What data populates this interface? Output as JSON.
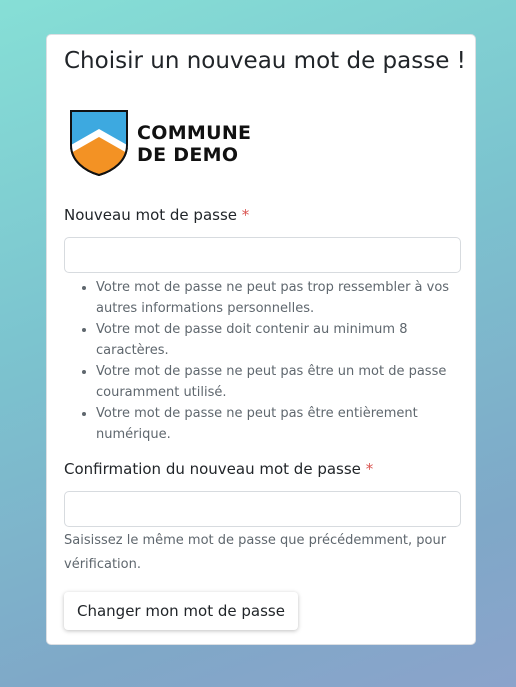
{
  "page": {
    "title": "Choisir un nouveau mot de passe !"
  },
  "logo": {
    "line1": "COMMUNE",
    "line2": "DE DEMO",
    "colors": {
      "sky": "#3da9e0",
      "orange": "#f39224",
      "outline": "#111111"
    }
  },
  "new_password": {
    "label": "Nouveau mot de passe",
    "required_mark": "*",
    "value": "",
    "placeholder": "",
    "rules": [
      "Votre mot de passe ne peut pas trop ressembler à vos autres informations personnelles.",
      "Votre mot de passe doit contenir au minimum 8 caractères.",
      "Votre mot de passe ne peut pas être un mot de passe couramment utilisé.",
      "Votre mot de passe ne peut pas être entièrement numérique."
    ]
  },
  "confirm_password": {
    "label": "Confirmation du nouveau mot de passe",
    "required_mark": "*",
    "value": "",
    "placeholder": "",
    "help": "Saisissez le même mot de passe que précédemment, pour vérification."
  },
  "submit": {
    "label": "Changer mon mot de passe"
  },
  "colors": {
    "required": "#d9534f",
    "help_text": "#5f676e"
  }
}
